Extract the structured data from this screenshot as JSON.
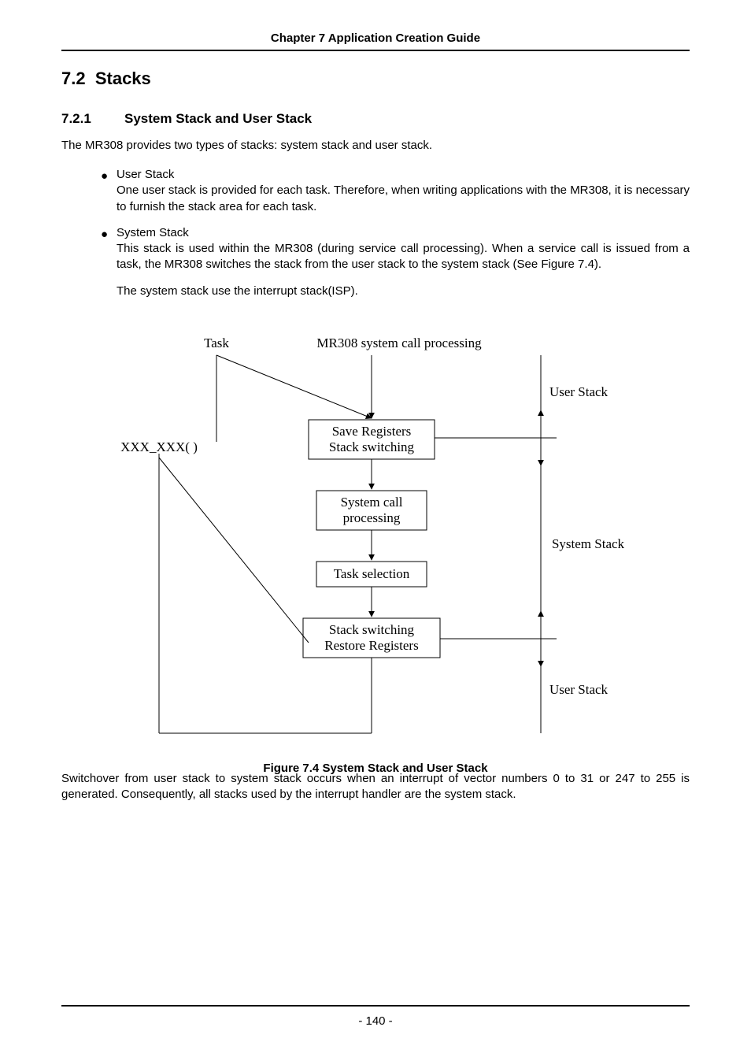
{
  "header": {
    "running_head": "Chapter 7 Application Creation Guide"
  },
  "section": {
    "number": "7.2",
    "title": "Stacks"
  },
  "subsection": {
    "number": "7.2.1",
    "title": "System Stack and User Stack",
    "intro": "The MR308 provides two types of stacks: system stack and user stack."
  },
  "bullets": [
    {
      "title": "User Stack",
      "body": "One user stack is provided for each task. Therefore, when writing applications with the MR308, it is necessary to furnish the stack area for each task."
    },
    {
      "title": "System Stack",
      "body": "This stack is used within the MR308 (during service call processing). When a service call is issued from a task, the MR308 switches the stack from the user stack to the system stack (See Figure 7.4).",
      "extra": "The system stack use the interrupt stack(ISP)."
    }
  ],
  "figure": {
    "caption": "Figure 7.4 System Stack and User Stack",
    "labels": {
      "task": "Task",
      "processing_title": "MR308 system call processing",
      "call": "XXX_XXX( )",
      "box1a": "Save Registers",
      "box1b": "Stack switching",
      "box2a": "System call",
      "box2b": "processing",
      "box3": "Task selection",
      "box4a": "Stack switching",
      "box4b": "Restore Registers",
      "user_stack": "User Stack",
      "system_stack": "System Stack"
    }
  },
  "closing": "Switchover from user stack to system stack occurs when an interrupt of vector numbers 0 to 31 or 247 to 255 is generated. Consequently, all stacks used by the interrupt handler are the system stack.",
  "footer": {
    "page": "- 140 -"
  }
}
